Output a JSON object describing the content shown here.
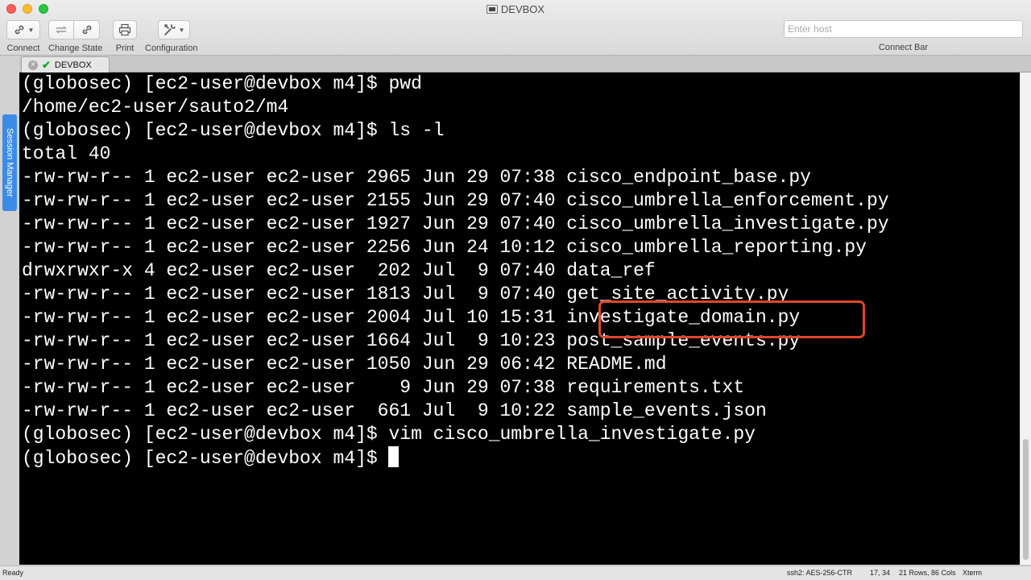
{
  "window": {
    "title": "DEVBOX"
  },
  "toolbar": {
    "connect": {
      "label": "Connect",
      "icon": "link-icon"
    },
    "change_state": {
      "label": "Change State",
      "icons": [
        "refresh-icon",
        "link-icon"
      ]
    },
    "print": {
      "label": "Print",
      "icon": "printer-icon"
    },
    "configuration": {
      "label": "Configuration",
      "icon": "tools-icon"
    },
    "connect_bar": {
      "label": "Connect Bar",
      "placeholder": "Enter host",
      "value": ""
    }
  },
  "tab": {
    "label": "DEVBOX"
  },
  "session_manager": {
    "label": "Session Manager"
  },
  "terminal": {
    "lines": [
      "(globosec) [ec2-user@devbox m4]$ pwd",
      "/home/ec2-user/sauto2/m4",
      "(globosec) [ec2-user@devbox m4]$ ls -l",
      "total 40",
      "-rw-rw-r-- 1 ec2-user ec2-user 2965 Jun 29 07:38 cisco_endpoint_base.py",
      "-rw-rw-r-- 1 ec2-user ec2-user 2155 Jun 29 07:40 cisco_umbrella_enforcement.py",
      "-rw-rw-r-- 1 ec2-user ec2-user 1927 Jun 29 07:40 cisco_umbrella_investigate.py",
      "-rw-rw-r-- 1 ec2-user ec2-user 2256 Jun 24 10:12 cisco_umbrella_reporting.py",
      "drwxrwxr-x 4 ec2-user ec2-user  202 Jul  9 07:40 data_ref",
      "-rw-rw-r-- 1 ec2-user ec2-user 1813 Jul  9 07:40 get_site_activity.py",
      "-rw-rw-r-- 1 ec2-user ec2-user 2004 Jul 10 15:31 investigate_domain.py",
      "-rw-rw-r-- 1 ec2-user ec2-user 1664 Jul  9 10:23 post_sample_events.py",
      "-rw-rw-r-- 1 ec2-user ec2-user 1050 Jun 29 06:42 README.md",
      "-rw-rw-r-- 1 ec2-user ec2-user    9 Jun 29 07:38 requirements.txt",
      "-rw-rw-r-- 1 ec2-user ec2-user  661 Jul  9 10:22 sample_events.json",
      "(globosec) [ec2-user@devbox m4]$ vim cisco_umbrella_investigate.py"
    ],
    "prompt": "(globosec) [ec2-user@devbox m4]$ ",
    "highlight_color": "#e0462a"
  },
  "statusbar": {
    "left": "Ready",
    "cipher": "ssh2: AES-256-CTR",
    "position": "17, 34",
    "size": "21 Rows, 86 Cols",
    "term": "Xterm"
  }
}
